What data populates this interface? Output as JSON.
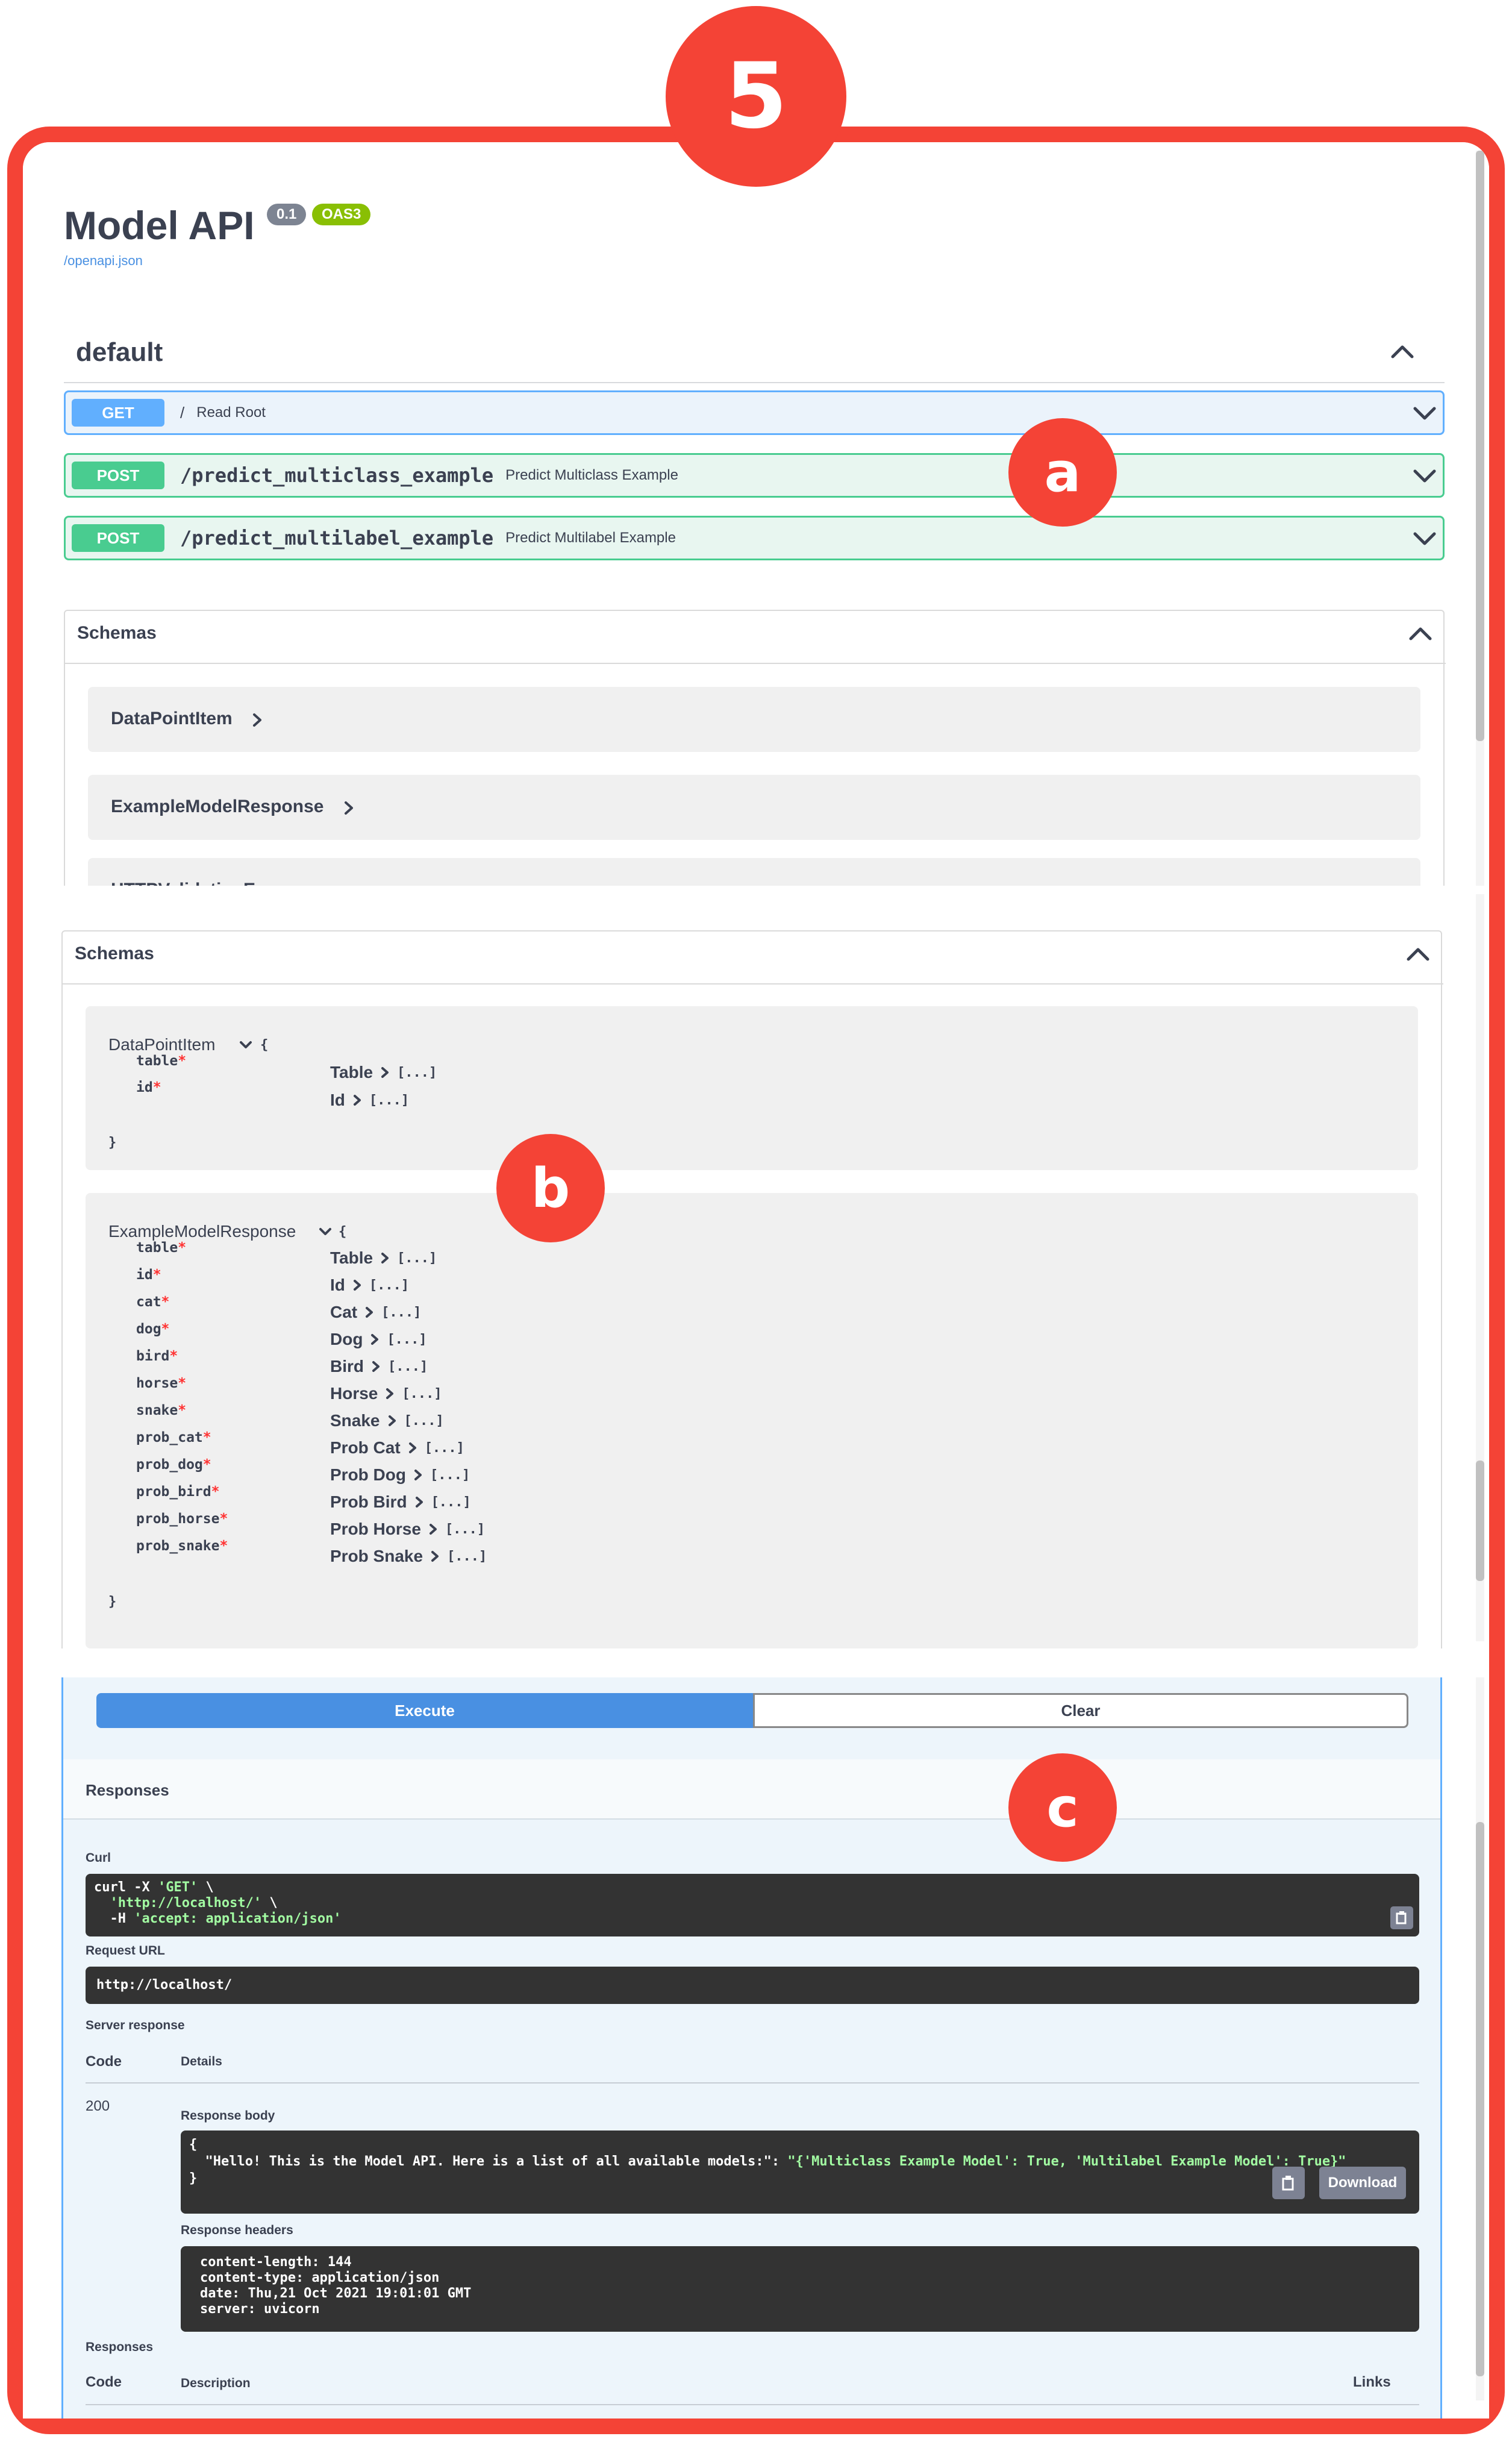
{
  "step_badge": "5",
  "callouts": {
    "a": "a",
    "b": "b",
    "c": "c"
  },
  "header": {
    "title": "Model API",
    "version": "0.1",
    "oas": "OAS3",
    "spec_link": "/openapi.json"
  },
  "default_section": {
    "title": "default",
    "operations": [
      {
        "method": "GET",
        "path": "/",
        "summary": "Read Root"
      },
      {
        "method": "POST",
        "path": "/predict_multiclass_example",
        "summary": "Predict Multiclass Example"
      },
      {
        "method": "POST",
        "path": "/predict_multilabel_example",
        "summary": "Predict Multilabel Example"
      }
    ]
  },
  "schemas_collapsed": {
    "title": "Schemas",
    "models": [
      "DataPointItem",
      "ExampleModelResponse",
      "HTTPValidationError"
    ]
  },
  "schemas_expanded": {
    "title": "Schemas",
    "datapoint": {
      "name": "DataPointItem",
      "open_brace": "{",
      "close_brace": "}",
      "props": [
        {
          "key": "table",
          "title": "Table"
        },
        {
          "key": "id",
          "title": "Id"
        }
      ]
    },
    "response": {
      "name": "ExampleModelResponse",
      "open_brace": "{",
      "close_brace": "}",
      "props": [
        {
          "key": "table",
          "title": "Table"
        },
        {
          "key": "id",
          "title": "Id"
        },
        {
          "key": "cat",
          "title": "Cat"
        },
        {
          "key": "dog",
          "title": "Dog"
        },
        {
          "key": "bird",
          "title": "Bird"
        },
        {
          "key": "horse",
          "title": "Horse"
        },
        {
          "key": "snake",
          "title": "Snake"
        },
        {
          "key": "prob_cat",
          "title": "Prob Cat"
        },
        {
          "key": "prob_dog",
          "title": "Prob Dog"
        },
        {
          "key": "prob_bird",
          "title": "Prob Bird"
        },
        {
          "key": "prob_horse",
          "title": "Prob Horse"
        },
        {
          "key": "prob_snake",
          "title": "Prob Snake"
        }
      ],
      "required_mark": "*",
      "collapsed_value": "[...]"
    }
  },
  "try_it": {
    "execute_label": "Execute",
    "clear_label": "Clear",
    "responses_title": "Responses",
    "curl_label": "Curl",
    "curl_lines": [
      {
        "pre": "curl -X ",
        "str": "'GET'",
        "post": " \\"
      },
      {
        "pre": "  ",
        "str": "'http://localhost/'",
        "post": " \\"
      },
      {
        "pre": "  -H ",
        "str": "'accept: application/json'",
        "post": ""
      }
    ],
    "request_url_label": "Request URL",
    "request_url": "http://localhost/",
    "server_response_label": "Server response",
    "code_header": "Code",
    "details_header": "Details",
    "status_code": "200",
    "response_body_label": "Response body",
    "response_body": {
      "open": "{",
      "key": "  \"Hello! This is the Model API. Here is a list of all available models:\": ",
      "value": "\"{'Multiclass Example Model': True, 'Multilabel Example Model': True}\"",
      "close": "}"
    },
    "download_label": "Download",
    "response_headers_label": "Response headers",
    "response_headers": [
      "content-length: 144",
      "content-type: application/json",
      "date: Thu,21 Oct 2021 19:01:01 GMT",
      "server: uvicorn"
    ],
    "responses_label": "Responses",
    "description_header": "Description",
    "links_header": "Links"
  },
  "colors": {
    "frame": "#f44336",
    "get": "#61affe",
    "post": "#49cc90",
    "execute": "#4990e2"
  }
}
